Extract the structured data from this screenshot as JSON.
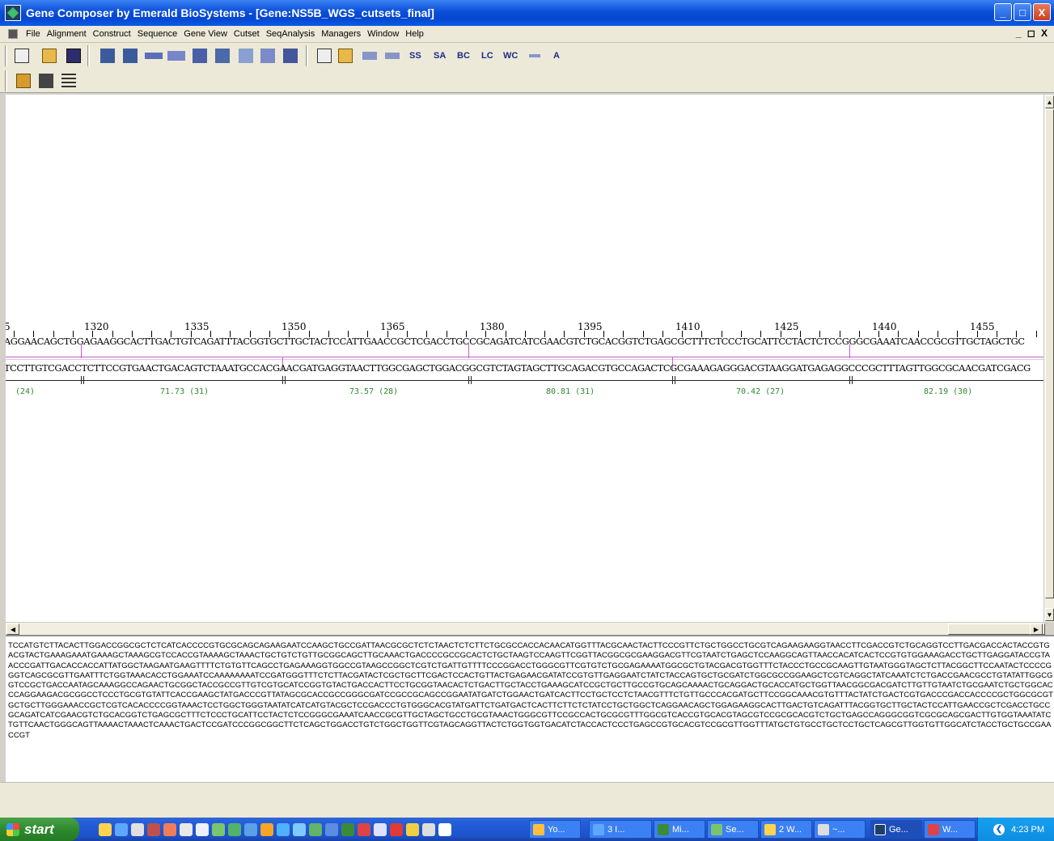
{
  "window": {
    "title": "Gene Composer by Emerald BioSystems - [Gene:NS5B_WGS_cutsets_final]",
    "controls": {
      "minimize": "_",
      "maximize": "□",
      "close": "X"
    }
  },
  "menubar": {
    "items": [
      "File",
      "Alignment",
      "Construct",
      "Sequence",
      "Gene View",
      "Cutset",
      "SeqAnalysis",
      "Managers",
      "Window",
      "Help"
    ],
    "mdi_controls": "_ ◻ X"
  },
  "toolbar": {
    "buttons": [
      {
        "name": "properties-icon",
        "label": ""
      },
      {
        "name": "open-icon",
        "label": ""
      },
      {
        "name": "save-icon",
        "label": ""
      },
      {
        "name": "translate-icon",
        "label": ""
      },
      {
        "name": "reverse-translate-icon",
        "label": ""
      },
      {
        "name": "dna-strand-icon",
        "label": ""
      },
      {
        "name": "align-icon",
        "label": ""
      },
      {
        "name": "construct-icon",
        "label": ""
      },
      {
        "name": "fragment-icon",
        "label": ""
      },
      {
        "name": "tree-icon",
        "label": ""
      },
      {
        "name": "blocks-icon",
        "label": ""
      },
      {
        "name": "report-icon",
        "label": ""
      },
      {
        "name": "open-folder-icon",
        "label": ""
      },
      {
        "name": "primer-icon",
        "label": ""
      },
      {
        "name": "oligo-icon",
        "label": ""
      },
      {
        "name": "ss-button",
        "label": "SS"
      },
      {
        "name": "sa-button",
        "label": "SA"
      },
      {
        "name": "bc-button",
        "label": "BC"
      },
      {
        "name": "lc-button",
        "label": "LC"
      },
      {
        "name": "wc-button",
        "label": "WC"
      },
      {
        "name": "bar-icon",
        "label": ""
      },
      {
        "name": "a-button",
        "label": "A"
      }
    ]
  },
  "ruler": {
    "positions": [
      "1320",
      "1335",
      "1350",
      "1365",
      "1380",
      "1395",
      "1410",
      "1425",
      "1440",
      "1455"
    ],
    "leading_fragment": "5"
  },
  "sequence": {
    "top_strand": "AGGAACAGCTGGAGAAGGCACTTGACTGTCAGATTTACGGTGCTTGCTACTCCATTGAACCGCTCGACCTGCCGCAGATCATCGAACGTCTGCACGGTCTGAGCGCTTTCTCCCTGCATTCCTACTCTCCGGGCGAAATCAACCGCGTTGCTAGCTGC",
    "bottom_strand": "TCCTTGTCGACCTCTTCCGTGAACTGACAGTCTAAATGCCACGAACGATGAGGTAACTTGGCGAGCTGGACGGCGTCTAGTAGCTTGCAGACGTGCCAGACTCGCGAAAGAGGGACGTAAGGATGAGAGGCCCGCTTTAGTTGGCGCAACGATCGACG"
  },
  "oligos": {
    "labels": [
      "(24)",
      "71.73 (31)",
      "73.57 (28)",
      "80.81 (31)",
      "70.42 (27)",
      "82.19 (30)"
    ]
  },
  "raw_sequence": "TCCATGTCTTACACTTGGACCGGCGCTCTCATCACCCCGTGCGCAGCAGAAGAATCCAAGCTGCCGATTAACGCGCTCTCTAACTCTCTTCTGCGCCACCACAACATGGTTTACGCAACTACTTCCCGTTCTGCTGGCCTGCGTCAGAAGAAGGTAACCTTCGACCGTCTGCAGGTCCTTGACGACCACTACCGTGACGTACTGAAAGAAATGAAAGCTAAAGCGTCCACCGTAAAAGCTAAACTGCTGTCTGTTGCGGCAGCTTGCAAACTGACCCCGCCGCACTCTGCTAAGTCCAAGTTCGGTTACGGCGCGAAGGACGTTCGTAATCTGAGCTCCAAGGCAGTTAACCACATCACTCCGTGTGGAAAGACCTGCTTGAGGATACCGTAACCCGATTGACACCACCATTATGGCTAAGAATGAAGTTTTCTGTGTTCAGCCTGAGAAAGGTGGCCGTAAGCCGGCTCGTCTGATTGTTTTCCCGGACCTGGGCGTTCGTGTCTGCGAGAAAATGGCGCTGTACGACGTGGTTTCTACCCTGCCGCAAGTTGTAATGGGTAGCTCTTACGGCTTCCAATACTCCCCGGGTCAGCGCGTTGAATTTCTGGTAAACACCTGGAAATCCAAAAAAAATCCGATGGGTTTCTCTTACGATACTCGCTGCTTCGACTCCACTGTTACTGAGAACGATATCCGTGTTGAGGAATCTATCTACCAGTGCTGCGATCTGGCGCCGGAAGCTCGTCAGGCTATCAAATCTCTGACCGAACGCCTGTATATTGGCGGTCCGCTGACCAATAGCAAAGGCCAGAACTGCGGCTACCGCCGTTGTCGTGCATCCGGTGTACTGACCACTTCCTGCGGTAACACTCTGACTTGCTACCTGAAAGCATCCGCTGCTTGCCGTGCAGCAAAACTGCAGGACTGCACCATGCTGGTTAACGGCGACGATCTTGTTGTAATCTGCGAATCTGCTGGCACCCAGGAAGACGCGGCCTCCCTGCGTGTATTCACCGAAGCTATGACCCGTTATAGCGCACCGCCGGGCGATCCGCCGCAGCCGGAATATGATCTGGAACTGATCACTTCCTGCTCCTCTAACGTTTCTGTTGCCCACGATGCTTCCGGCAAACGTGTTTACTATCTGACTCGTGACCCGACCACCCCGCTGGCGCGTGCTGCTTGGGAAACCGCTCGTCACACCCCGGTAAACTCCTGGCTGGGTAATATCATCATGTACGCTCCGACCCTGTGGGCACGTATGATTCTGATGACTCACTTCTTCTCTATCCTGCTGGCTCAGGAACAGCTGGAGAAGGCACTTGACTGTCAGATTTACGGTGCTTGCTACTCCATTGAACCGCTCGACCTGCCGCAGATCATCGAACGTCTGCACGGTCTGAGCGCTTTCTCCCTGCATTCCTACTCTCCGGGCGAAATCAACCGCGTTGCTAGCTGCCTGCGTAAACTGGGCGTTCCGCCACTGCGCGTTTGGCGTCACCGTGCACGTAGCGTCCGCGCACGTCTGCTGAGCCAGGGCGGTCGCGCAGCGACTTGTGGTAAATATCTGTTCAACTGGGCAGTTAAAACTAAACTCAAACTGACTCCGATCCCGGCGGCTTCTCAGCTGGACCTGTCTGGCTGGTTCGTAGCAGGTTACTCTGGTGGTGACATCTACCACTCCCTGAGCCGTGCACGTCCGCGTTGGTTTATGCTGTGCCTGCTCCTGCTCAGCGTTGGTGTTGGCATCTACCTGCTGCCGAACCGT",
  "taskbar": {
    "start_label": "start",
    "tasks": [
      {
        "label": "Yo..."
      },
      {
        "label": "3 I..."
      },
      {
        "label": "Mi..."
      },
      {
        "label": "Se..."
      },
      {
        "label": "2 W..."
      },
      {
        "label": "~..."
      },
      {
        "label": "Ge..."
      },
      {
        "label": "W..."
      }
    ],
    "clock": "4:23 PM"
  },
  "colors": {
    "titlebar": "#0a4fd8",
    "taskbar": "#245edc",
    "oligo_label": "#2e8b2e",
    "cut_marker": "#c060c0"
  }
}
